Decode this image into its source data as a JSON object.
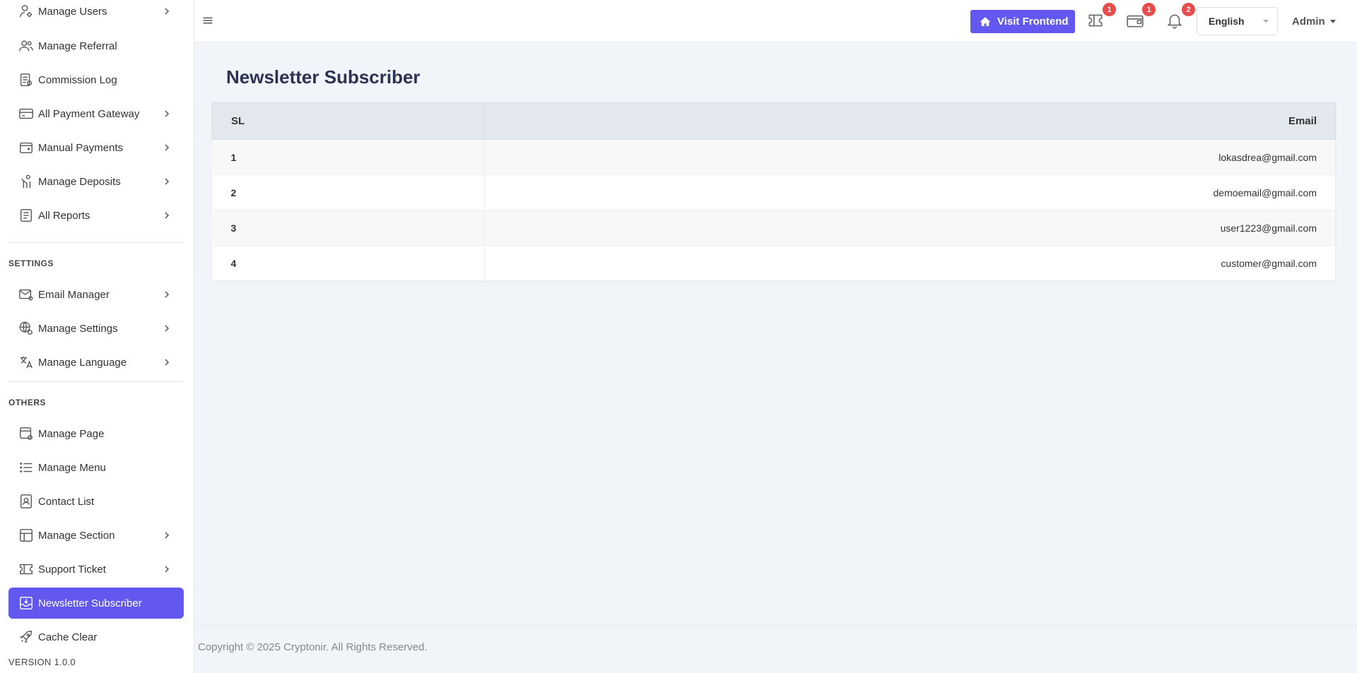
{
  "sidebar": {
    "items_top": [
      {
        "label": "Manage Users",
        "icon": "user-gear-icon",
        "chevron": true
      },
      {
        "label": "Manage Referral",
        "icon": "users-icon",
        "chevron": false
      },
      {
        "label": "Commission Log",
        "icon": "document-icon",
        "chevron": false
      },
      {
        "label": "All Payment Gateway",
        "icon": "credit-card-icon",
        "chevron": true
      },
      {
        "label": "Manual Payments",
        "icon": "wallet-icon",
        "chevron": true
      },
      {
        "label": "Manage Deposits",
        "icon": "hand-coin-icon",
        "chevron": true
      },
      {
        "label": "All Reports",
        "icon": "report-icon",
        "chevron": true
      }
    ],
    "settings_title": "SETTINGS",
    "items_settings": [
      {
        "label": "Email Manager",
        "icon": "mail-gear-icon",
        "chevron": true
      },
      {
        "label": "Manage Settings",
        "icon": "globe-gear-icon",
        "chevron": true
      },
      {
        "label": "Manage Language",
        "icon": "translate-icon",
        "chevron": true
      }
    ],
    "others_title": "OTHERS",
    "items_others": [
      {
        "label": "Manage Page",
        "icon": "page-gear-icon",
        "chevron": false
      },
      {
        "label": "Manage Menu",
        "icon": "list-icon",
        "chevron": false
      },
      {
        "label": "Contact List",
        "icon": "contact-icon",
        "chevron": false
      },
      {
        "label": "Manage Section",
        "icon": "layout-icon",
        "chevron": true
      },
      {
        "label": "Support Ticket",
        "icon": "ticket-icon",
        "chevron": true
      },
      {
        "label": "Newsletter Subscriber",
        "icon": "inbox-icon",
        "chevron": false,
        "active": true
      },
      {
        "label": "Cache Clear",
        "icon": "rocket-icon",
        "chevron": false
      }
    ],
    "version": "VERSION 1.0.0"
  },
  "header": {
    "visit_label": "Visit Frontend",
    "ticket_badge": "1",
    "wallet_badge": "1",
    "bell_badge": "2",
    "language": "English",
    "user": "Admin"
  },
  "main": {
    "title": "Newsletter Subscriber",
    "columns": [
      "SL",
      "Email"
    ],
    "rows": [
      {
        "sl": "1",
        "email": "lokasdrea@gmail.com"
      },
      {
        "sl": "2",
        "email": "demoemail@gmail.com"
      },
      {
        "sl": "3",
        "email": "user1223@gmail.com"
      },
      {
        "sl": "4",
        "email": "customer@gmail.com"
      }
    ]
  },
  "footer": {
    "copyright": "Copyright © 2025 Cryptonir. All Rights Reserved."
  },
  "colors": {
    "accent": "#6258f0",
    "badge": "#e84b4b",
    "title": "#2c3352"
  }
}
